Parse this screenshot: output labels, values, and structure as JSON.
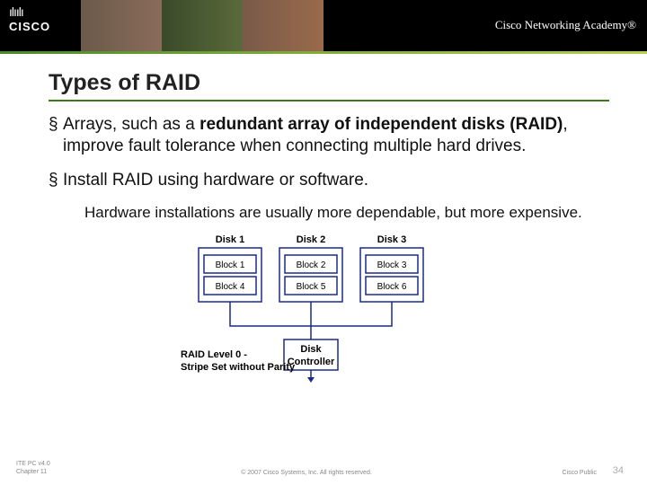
{
  "banner": {
    "logo_bars": "ılıılı",
    "logo_text": "CISCO",
    "academy": "Cisco Networking Academy®"
  },
  "slide": {
    "title": "Types of RAID",
    "bullets": [
      {
        "pre": "Arrays, such as a ",
        "bold": "redundant array of independent disks (RAID)",
        "post": ", improve fault tolerance when connecting multiple hard drives."
      },
      {
        "pre": "Install RAID using hardware or software.",
        "bold": "",
        "post": ""
      }
    ],
    "sub": "Hardware installations are usually more dependable, but more expensive."
  },
  "diagram": {
    "disks": [
      "Disk 1",
      "Disk 2",
      "Disk 3"
    ],
    "blocks_row1": [
      "Block 1",
      "Block 2",
      "Block 3"
    ],
    "blocks_row2": [
      "Block 4",
      "Block 5",
      "Block 6"
    ],
    "caption1": "RAID Level 0 -",
    "caption2": "Stripe Set without Parity",
    "controller1": "Disk",
    "controller2": "Controller"
  },
  "footer": {
    "line1": "ITE PC v4.0",
    "line2": "Chapter 11",
    "copyright": "© 2007 Cisco Systems, Inc. All rights reserved.",
    "scope": "Cisco Public",
    "page": "34"
  }
}
